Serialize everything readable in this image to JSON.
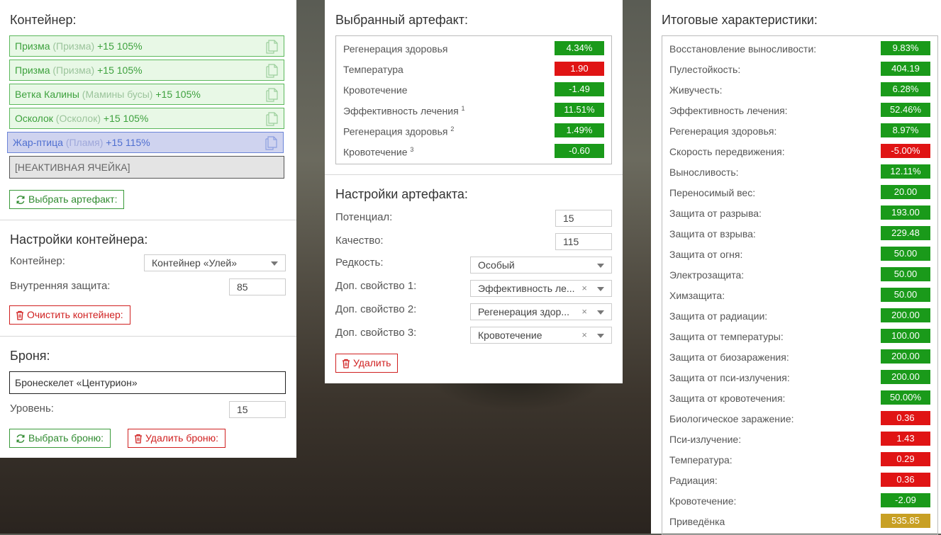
{
  "container": {
    "title": "Контейнер:",
    "slots": [
      {
        "name": "Призма",
        "sub": "(Призма)",
        "bonus": "+15 105%"
      },
      {
        "name": "Призма",
        "sub": "(Призма)",
        "bonus": "+15 105%"
      },
      {
        "name": "Ветка Калины",
        "sub": "(Мамины бусы)",
        "bonus": "+15 105%"
      },
      {
        "name": "Осколок",
        "sub": "(Осколок)",
        "bonus": "+15 105%"
      },
      {
        "name": "Жар-птица",
        "sub": "(Пламя)",
        "bonus": "+15 115%"
      }
    ],
    "inactive_slot": "[НЕАКТИВНАЯ ЯЧЕЙКА]",
    "select_artifact_label": "Выбрать артефакт:"
  },
  "container_settings": {
    "title": "Настройки контейнера:",
    "container_label": "Контейнер:",
    "container_value": "Контейнер «Улей»",
    "protection_label": "Внутренняя защита:",
    "protection_value": "85",
    "clear_label": "Очистить контейнер:"
  },
  "armor": {
    "title": "Броня:",
    "name": "Бронескелет «Центурион»",
    "level_label": "Уровень:",
    "level_value": "15",
    "select_label": "Выбрать броню:",
    "delete_label": "Удалить броню:"
  },
  "selected_artifact": {
    "title": "Выбранный артефакт:",
    "stats": [
      {
        "name": "Регенерация здоровья",
        "sup": "",
        "value": "4.34%",
        "kind": "pos"
      },
      {
        "name": "Температура",
        "sup": "",
        "value": "1.90",
        "kind": "neg"
      },
      {
        "name": "Кровотечение",
        "sup": "",
        "value": "-1.49",
        "kind": "pos"
      },
      {
        "name": "Эффективность лечения",
        "sup": "1",
        "value": "11.51%",
        "kind": "pos"
      },
      {
        "name": "Регенерация здоровья",
        "sup": "2",
        "value": "1.49%",
        "kind": "pos"
      },
      {
        "name": "Кровотечение",
        "sup": "3",
        "value": "-0.60",
        "kind": "pos"
      }
    ]
  },
  "artifact_settings": {
    "title": "Настройки артефакта:",
    "potential_label": "Потенциал:",
    "potential_value": "15",
    "quality_label": "Качество:",
    "quality_value": "115",
    "rarity_label": "Редкость:",
    "rarity_value": "Особый",
    "prop1_label": "Доп. свойство 1:",
    "prop1_value": "Эффективность ле...",
    "prop2_label": "Доп. свойство 2:",
    "prop2_value": "Регенерация здор...",
    "prop3_label": "Доп. свойство 3:",
    "prop3_value": "Кровотечение",
    "clear_glyph": "×",
    "delete_label": "Удалить"
  },
  "totals": {
    "title": "Итоговые характеристики:",
    "stats": [
      {
        "name": "Восстановление выносливости:",
        "value": "9.83%",
        "kind": "pos"
      },
      {
        "name": "Пулестойкость:",
        "value": "404.19",
        "kind": "pos"
      },
      {
        "name": "Живучесть:",
        "value": "6.28%",
        "kind": "pos"
      },
      {
        "name": "Эффективность лечения:",
        "value": "52.46%",
        "kind": "pos"
      },
      {
        "name": "Регенерация здоровья:",
        "value": "8.97%",
        "kind": "pos"
      },
      {
        "name": "Скорость передвижения:",
        "value": "-5.00%",
        "kind": "neg"
      },
      {
        "name": "Выносливость:",
        "value": "12.11%",
        "kind": "pos"
      },
      {
        "name": "Переносимый вес:",
        "value": "20.00",
        "kind": "pos"
      },
      {
        "name": "Защита от разрыва:",
        "value": "193.00",
        "kind": "pos"
      },
      {
        "name": "Защита от взрыва:",
        "value": "229.48",
        "kind": "pos"
      },
      {
        "name": "Защита от огня:",
        "value": "50.00",
        "kind": "pos"
      },
      {
        "name": "Электрозащита:",
        "value": "50.00",
        "kind": "pos"
      },
      {
        "name": "Химзащита:",
        "value": "50.00",
        "kind": "pos"
      },
      {
        "name": "Защита от радиации:",
        "value": "200.00",
        "kind": "pos"
      },
      {
        "name": "Защита от температуры:",
        "value": "100.00",
        "kind": "pos"
      },
      {
        "name": "Защита от биозаражения:",
        "value": "200.00",
        "kind": "pos"
      },
      {
        "name": "Защита от пси-излучения:",
        "value": "200.00",
        "kind": "pos"
      },
      {
        "name": "Защита от кровотечения:",
        "value": "50.00%",
        "kind": "pos"
      },
      {
        "name": "Биологическое заражение:",
        "value": "0.36",
        "kind": "neg"
      },
      {
        "name": "Пси-излучение:",
        "value": "1.43",
        "kind": "neg"
      },
      {
        "name": "Температура:",
        "value": "0.29",
        "kind": "neg"
      },
      {
        "name": "Радиация:",
        "value": "0.36",
        "kind": "neg"
      },
      {
        "name": "Кровотечение:",
        "value": "-2.09",
        "kind": "pos"
      },
      {
        "name": "Приведёнка",
        "value": "535.85",
        "kind": "gold"
      }
    ]
  },
  "colors": {
    "positive": "#1a9a1a",
    "negative": "#e01414",
    "gold": "#c8a024",
    "slot_green": "#5cb85c",
    "slot_blue": "#6b84d8"
  },
  "icons": {
    "copy": "copy-icon",
    "refresh": "refresh-icon",
    "trash": "trash-icon",
    "caret": "chevron-down-icon"
  }
}
